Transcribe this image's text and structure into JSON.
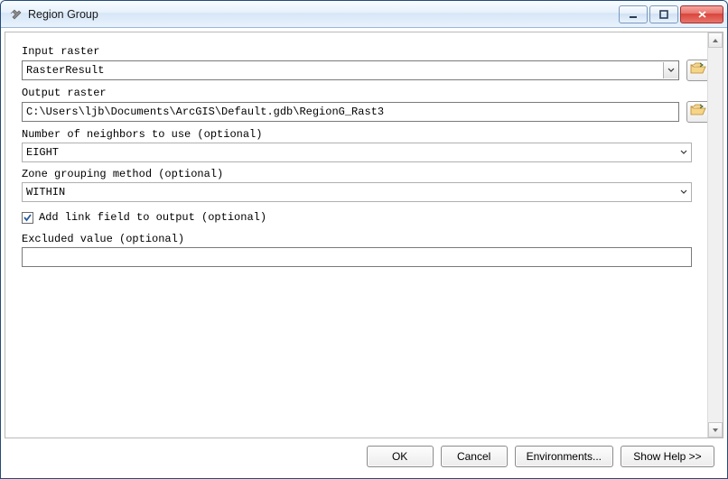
{
  "window": {
    "title": "Region Group"
  },
  "form": {
    "input_raster_label": "Input raster",
    "input_raster_value": "RasterResult",
    "output_raster_label": "Output raster",
    "output_raster_value": "C:\\Users\\ljb\\Documents\\ArcGIS\\Default.gdb\\RegionG_Rast3",
    "neighbors_label": "Number of neighbors to use (optional)",
    "neighbors_value": "EIGHT",
    "zone_label": "Zone grouping method (optional)",
    "zone_value": "WITHIN",
    "addlink_checked": true,
    "addlink_label": "Add link field to output (optional)",
    "excluded_label": "Excluded value (optional)",
    "excluded_value": ""
  },
  "buttons": {
    "ok": "OK",
    "cancel": "Cancel",
    "environments": "Environments...",
    "showhelp": "Show Help >>"
  }
}
